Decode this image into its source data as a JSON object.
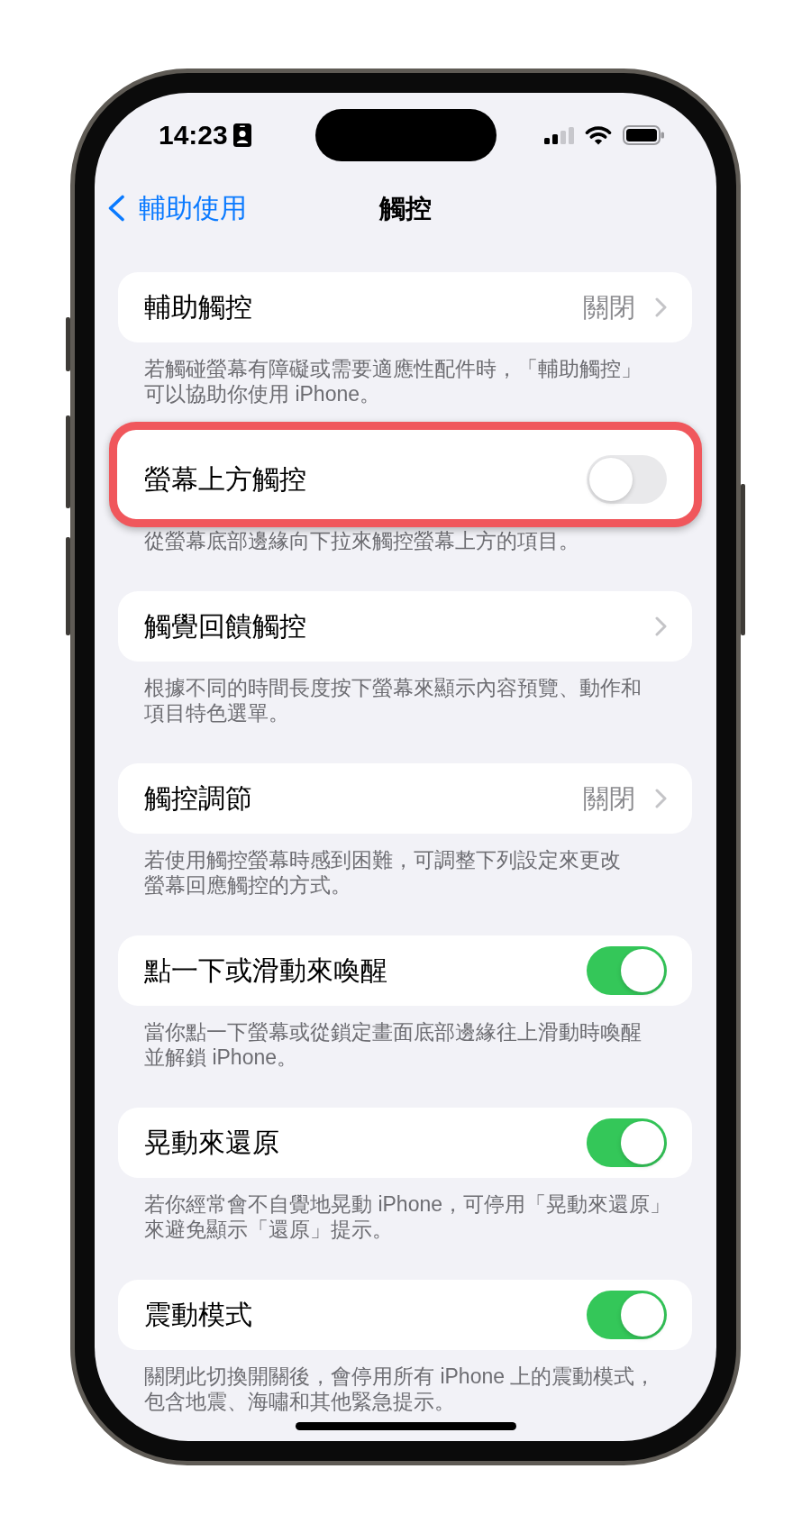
{
  "status_bar": {
    "time": "14:23"
  },
  "nav": {
    "back": "輔助使用",
    "title": "觸控"
  },
  "sections": [
    {
      "kind": "link",
      "label": "輔助觸控",
      "value": "關閉",
      "highlighted": false,
      "description": "若觸碰螢幕有障礙或需要適應性配件時，「輔助觸控」可以協助你使用 iPhone。"
    },
    {
      "kind": "toggle",
      "label": "螢幕上方觸控",
      "on": false,
      "highlighted": true,
      "description": "從螢幕底部邊緣向下拉來觸控螢幕上方的項目。"
    },
    {
      "kind": "link",
      "label": "觸覺回饋觸控",
      "highlighted": false,
      "description": "根據不同的時間長度按下螢幕來顯示內容預覽、動作和項目特色選單。"
    },
    {
      "kind": "link",
      "label": "觸控調節",
      "value": "關閉",
      "highlighted": false,
      "description": "若使用觸控螢幕時感到困難，可調整下列設定來更改螢幕回應觸控的方式。"
    },
    {
      "kind": "toggle",
      "label": "點一下或滑動來喚醒",
      "on": true,
      "highlighted": false,
      "description": "當你點一下螢幕或從鎖定畫面底部邊緣往上滑動時喚醒並解鎖 iPhone。"
    },
    {
      "kind": "toggle",
      "label": "晃動來還原",
      "on": true,
      "highlighted": false,
      "description": "若你經常會不自覺地晃動 iPhone，可停用「晃動來還原」來避免顯示「還原」提示。"
    },
    {
      "kind": "toggle",
      "label": "震動模式",
      "on": true,
      "highlighted": false,
      "description": "關閉此切換開關後，會停用所有 iPhone 上的震動模式，包含地震、海嘯和其他緊急提示。"
    }
  ]
}
